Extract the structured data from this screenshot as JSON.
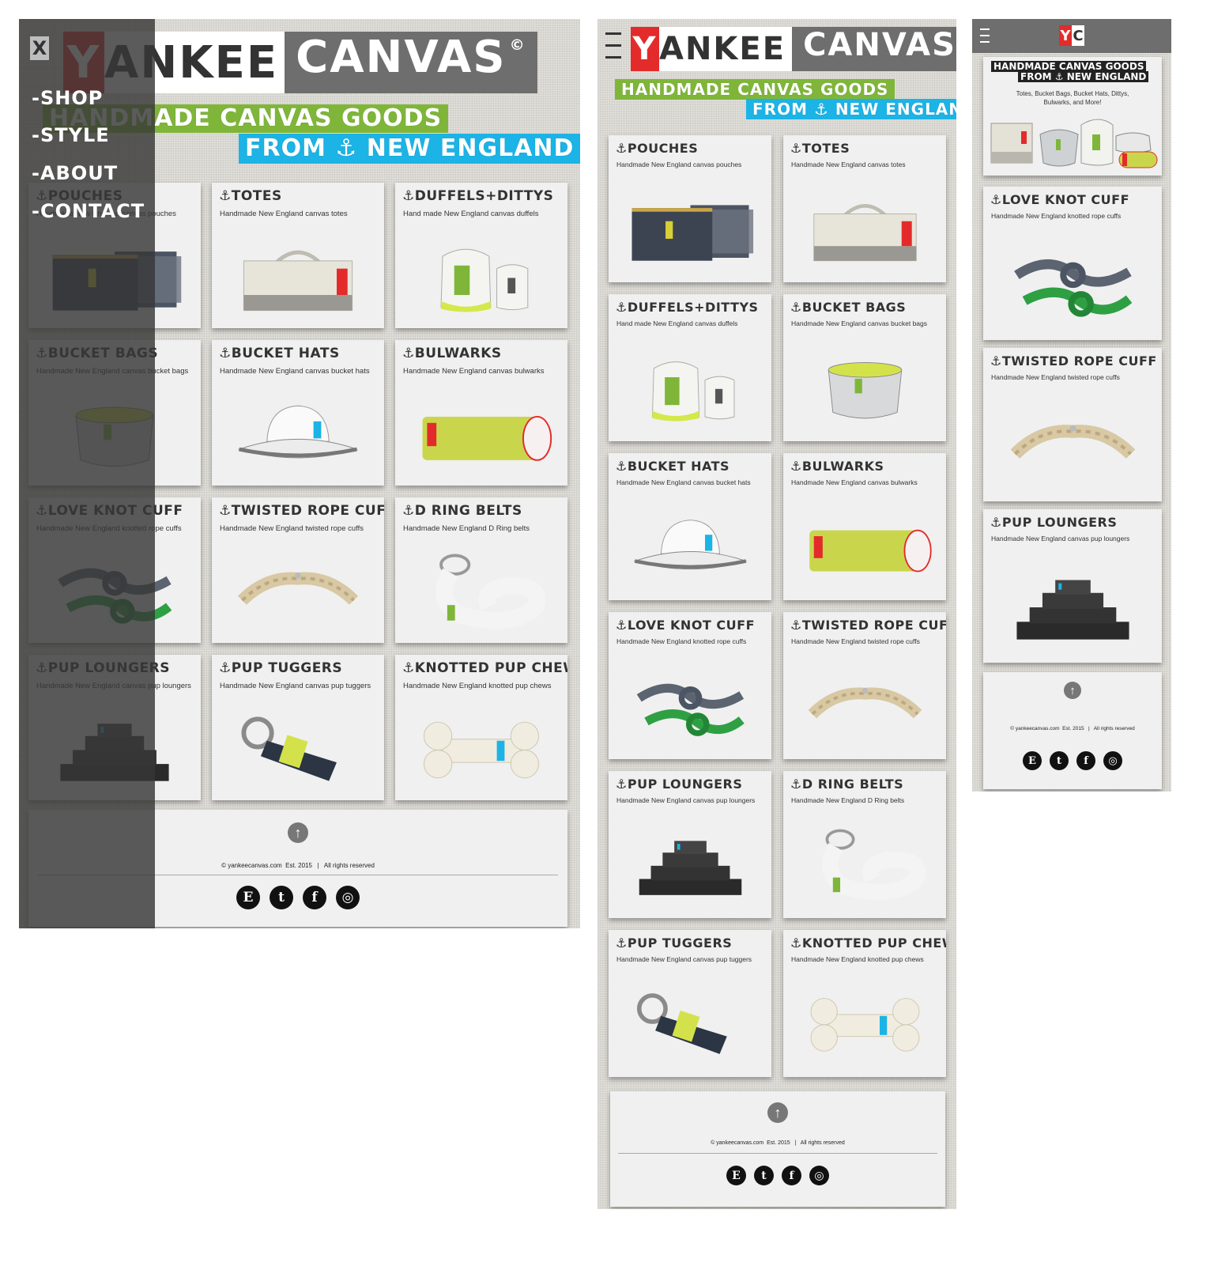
{
  "brand": {
    "y": "Y",
    "ankee": "ANKEE",
    "canvas": "CANVAS",
    "copyright": "©",
    "monogram_y": "Y",
    "monogram_c": "C"
  },
  "tagline": {
    "line1": "HANDMADE CANVAS GOODS",
    "line2": "FROM ⚓ NEW ENGLAND"
  },
  "nav_menu": {
    "close": "X",
    "items": [
      "-SHOP",
      "-STYLE",
      "-ABOUT",
      "-CONTACT"
    ]
  },
  "products": {
    "pouches": {
      "title": "⚓POUCHES",
      "desc": "Handmade New England canvas pouches"
    },
    "totes": {
      "title": "⚓TOTES",
      "desc": "Handmade New England canvas totes"
    },
    "duffels": {
      "title": "⚓DUFFELS+DITTYS",
      "desc": "Hand made New England canvas duffels"
    },
    "bucket_bags": {
      "title": "⚓BUCKET BAGS",
      "desc": "Handmade New England canvas bucket bags"
    },
    "bucket_hats": {
      "title": "⚓BUCKET HATS",
      "desc": "Handmade New England canvas bucket hats"
    },
    "bulwarks": {
      "title": "⚓BULWARKS",
      "desc": "Handmade New England canvas bulwarks"
    },
    "love_knot": {
      "title": "⚓LOVE KNOT CUFF",
      "desc": "Handmade New England knotted rope cuffs"
    },
    "twisted_rope": {
      "title": "⚓TWISTED ROPE CUFF",
      "desc": "Handmade New England twisted rope cuffs"
    },
    "d_ring": {
      "title": "⚓D RING BELTS",
      "desc": "Handmade New England D Ring belts"
    },
    "pup_loungers": {
      "title": "⚓PUP LOUNGERS",
      "desc": "Handmade New England canvas pup loungers"
    },
    "pup_tuggers": {
      "title": "⚓PUP TUGGERS",
      "desc": "Handmade New England canvas pup tuggers"
    },
    "pup_chew": {
      "title": "⚓KNOTTED PUP CHEW",
      "desc": "Handmade New England knotted pup chews"
    }
  },
  "mobile_hero": {
    "tag1": "HANDMADE CANVAS GOODS",
    "tag2": "FROM ⚓ NEW ENGLAND",
    "text1": "Totes, Bucket Bags, Bucket Hats, Dittys,",
    "text2": "Bulwarks, and More!"
  },
  "footer": {
    "copyright": "© yankeecanvas.com  Est. 2015   |   All rights reserved",
    "up": "↑",
    "social": [
      "E",
      "t",
      "f",
      "◎"
    ]
  },
  "colors": {
    "red": "#e32b2b",
    "green": "#7fb63a",
    "blue": "#1cb3e6",
    "dark": "#6e6e6e"
  }
}
